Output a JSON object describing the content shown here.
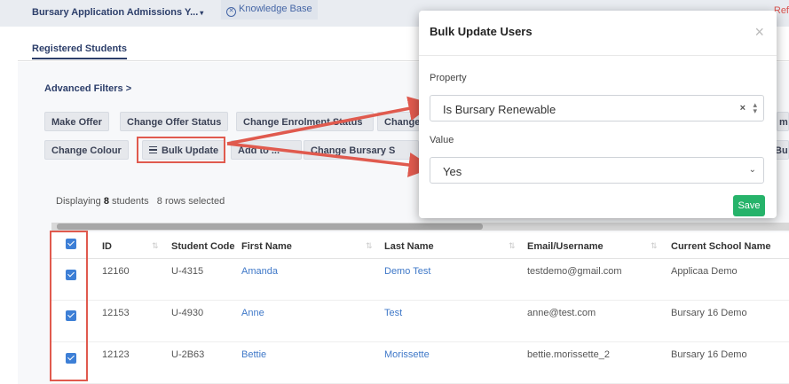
{
  "header": {
    "app_title": "Bursary Application Admissions Y...",
    "app_title_caret": "▾",
    "knowledge_base": "Knowledge Base",
    "right_fragment": "Ref"
  },
  "tabs": {
    "registered_students": "Registered Students"
  },
  "filters": {
    "advanced_filters": "Advanced Filters",
    "chevron": ">"
  },
  "actions": {
    "row1": [
      "Make Offer",
      "Change Offer Status",
      "Change Enrolment Status",
      "Change",
      "m"
    ],
    "row2": [
      "Change Colour",
      "Bulk Update",
      "Add to ...",
      "Change Bursary S",
      "Bu"
    ]
  },
  "status": {
    "prefix": "Displaying",
    "count": "8",
    "suffix": "students",
    "selected": "8 rows selected"
  },
  "table": {
    "columns": [
      "ID",
      "Student Code",
      "First Name",
      "Last Name",
      "Email/Username",
      "Current School Name"
    ],
    "rows": [
      {
        "id": "12160",
        "code": "U-4315",
        "first": "Amanda",
        "last": "Demo Test",
        "email": "testdemo@gmail.com",
        "school": "Applicaa Demo"
      },
      {
        "id": "12153",
        "code": "U-4930",
        "first": "Anne",
        "last": "Test",
        "email": "anne@test.com",
        "school": "Bursary 16 Demo"
      },
      {
        "id": "12123",
        "code": "U-2B63",
        "first": "Bettie",
        "last": "Morissette",
        "email": "bettie.morissette_2",
        "school": "Bursary 16 Demo"
      }
    ]
  },
  "modal": {
    "title": "Bulk Update Users",
    "close": "×",
    "property_label": "Property",
    "property_value": "Is Bursary Renewable",
    "clear": "×",
    "value_label": "Value",
    "value_value": "Yes",
    "save": "Save"
  },
  "colors": {
    "accent_red": "#e05a4e",
    "save_green": "#26b36a",
    "link_blue": "#3f78c8",
    "checkbox_blue": "#3d7fd6"
  }
}
